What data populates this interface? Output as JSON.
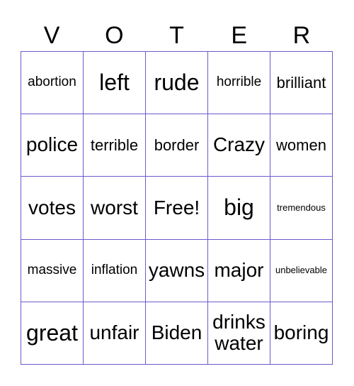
{
  "header": [
    "V",
    "O",
    "T",
    "E",
    "R"
  ],
  "cells": [
    {
      "text": "abortion",
      "size": "s4"
    },
    {
      "text": "left",
      "size": "s1"
    },
    {
      "text": "rude",
      "size": "s1"
    },
    {
      "text": "horrible",
      "size": "s4"
    },
    {
      "text": "brilliant",
      "size": "s3"
    },
    {
      "text": "police",
      "size": "s2"
    },
    {
      "text": "terrible",
      "size": "s3"
    },
    {
      "text": "border",
      "size": "s3"
    },
    {
      "text": "Crazy",
      "size": "s2"
    },
    {
      "text": "women",
      "size": "s3"
    },
    {
      "text": "votes",
      "size": "s2"
    },
    {
      "text": "worst",
      "size": "s2"
    },
    {
      "text": "Free!",
      "size": "s2"
    },
    {
      "text": "big",
      "size": "s1"
    },
    {
      "text": "tremendous",
      "size": "s5"
    },
    {
      "text": "massive",
      "size": "s4"
    },
    {
      "text": "inflation",
      "size": "s4"
    },
    {
      "text": "yawns",
      "size": "s2"
    },
    {
      "text": "major",
      "size": "s2"
    },
    {
      "text": "unbelievable",
      "size": "s5"
    },
    {
      "text": "great",
      "size": "s1"
    },
    {
      "text": "unfair",
      "size": "s2"
    },
    {
      "text": "Biden",
      "size": "s2"
    },
    {
      "text": "drinks water",
      "size": "s2"
    },
    {
      "text": "boring",
      "size": "s2"
    }
  ]
}
